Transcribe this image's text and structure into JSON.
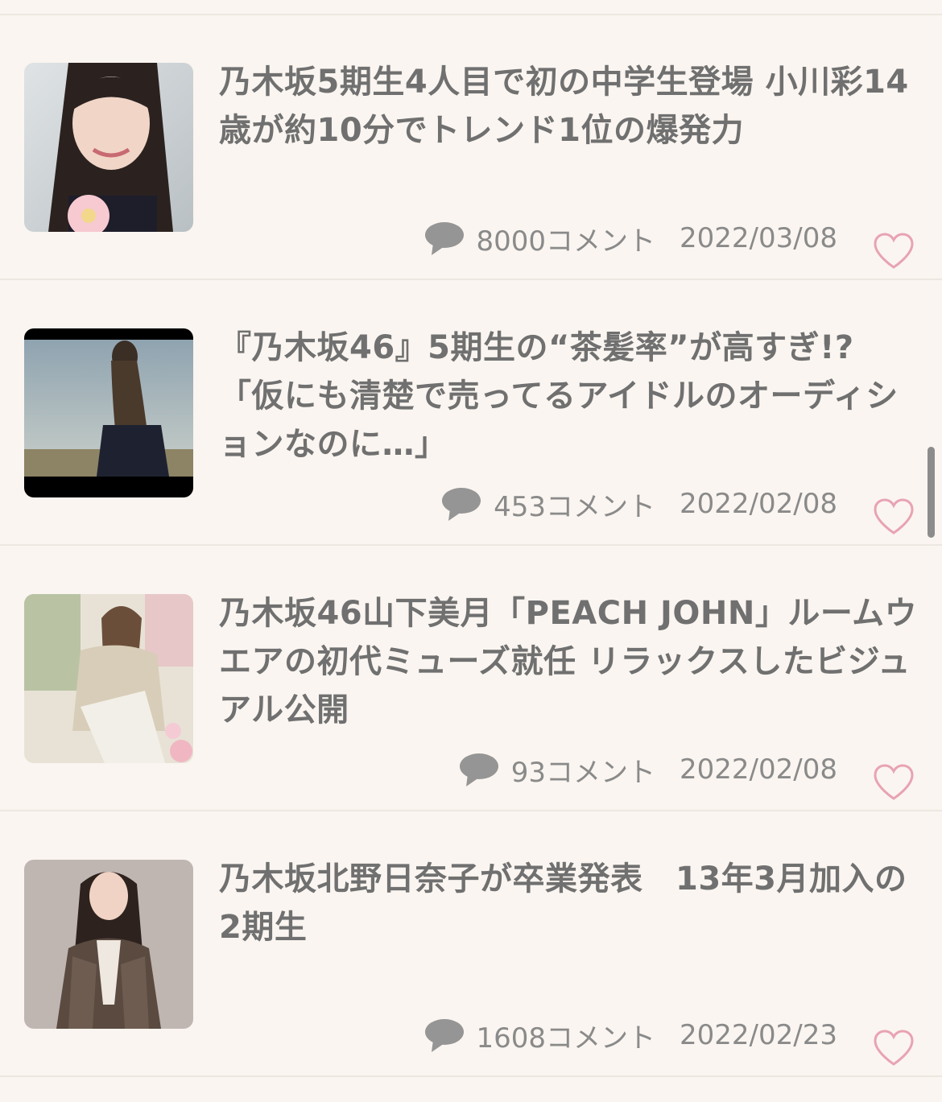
{
  "articles": [
    {
      "title": "乃木坂5期生4人目で初の中学生登場 小川彩14歳が約10分でトレンド1位の爆発力",
      "comments": "8000コメント",
      "date": "2022/03/08"
    },
    {
      "title": "『乃木坂46』5期生の“茶髪率”が高すぎ!?「仮にも清楚で売ってるアイドルのオーディションなのに…」",
      "comments": "453コメント",
      "date": "2022/02/08"
    },
    {
      "title": "乃木坂46山下美月「PEACH JOHN」ルームウエアの初代ミューズ就任 リラックスしたビジュアル公開",
      "comments": "93コメント",
      "date": "2022/02/08"
    },
    {
      "title": "乃木坂北野日奈子が卒業発表　13年3月加入の2期生",
      "comments": "1608コメント",
      "date": "2022/02/23"
    }
  ],
  "icons": {
    "comment": "speech-bubble-icon",
    "favorite": "heart-outline-icon"
  },
  "colors": {
    "background": "#faf5f0",
    "title_text": "#707070",
    "meta_text": "#8a8a8a",
    "heart": "#e8a3b3",
    "divider": "#eee7e1"
  }
}
